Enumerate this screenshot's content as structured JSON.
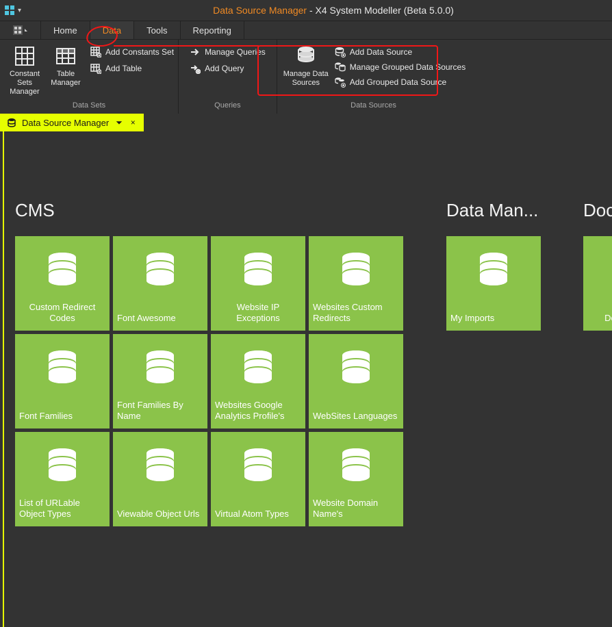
{
  "title": {
    "accent": "Data Source Manager",
    "rest": " - X4 System Modeller (Beta 5.0.0)"
  },
  "menubar": {
    "file_caret": "▾",
    "tabs": [
      "Home",
      "Data",
      "Tools",
      "Reporting"
    ],
    "active_index": 1
  },
  "ribbon": {
    "groups": [
      {
        "label": "Data Sets",
        "big": [
          {
            "name": "constant-sets-manager",
            "label": "Constant Sets Manager",
            "icon": "grid"
          },
          {
            "name": "table-manager",
            "label": "Table Manager",
            "icon": "table"
          }
        ],
        "small": [
          {
            "name": "add-constants-set",
            "label": "Add Constants Set",
            "icon": "grid-add"
          },
          {
            "name": "add-table",
            "label": "Add Table",
            "icon": "table-add"
          }
        ]
      },
      {
        "label": "Queries",
        "small": [
          {
            "name": "manage-queries",
            "label": "Manage Queries",
            "icon": "arrow"
          },
          {
            "name": "add-query",
            "label": "Add Query",
            "icon": "arrow-add"
          }
        ]
      },
      {
        "label": "Data Sources",
        "big": [
          {
            "name": "manage-data-sources",
            "label": "Manage Data Sources",
            "icon": "db"
          }
        ],
        "small": [
          {
            "name": "add-data-source",
            "label": "Add Data Source",
            "icon": "db-add"
          },
          {
            "name": "manage-grouped-data-sources",
            "label": "Manage Grouped Data Sources",
            "icon": "db-group"
          },
          {
            "name": "add-grouped-data-source",
            "label": "Add Grouped Data Source",
            "icon": "db-group-add"
          }
        ]
      }
    ]
  },
  "doctab": {
    "label": "Data Source Manager",
    "pin": "⏷",
    "close": "×"
  },
  "categories": [
    {
      "title": "CMS",
      "tiles": [
        "Custom Redirect Codes",
        "Font Awesome",
        "Website IP Exceptions",
        "Websites Custom Redirects",
        "Font Families",
        "Font Families By Name",
        "Websites Google Analytics Profile's",
        "WebSites Languages",
        "List of URLable Object Types",
        "Viewable Object Urls",
        "Virtual Atom Types",
        "Website Domain Name's"
      ]
    },
    {
      "title": "Data Man...",
      "tiles": [
        "My Imports"
      ]
    },
    {
      "title": "Docun",
      "tiles": [
        "Docun Comp"
      ]
    }
  ]
}
